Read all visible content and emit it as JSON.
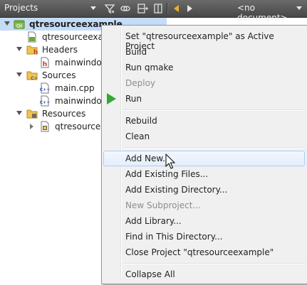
{
  "toolbar": {
    "panel_title": "Projects",
    "document_label": "<no document>",
    "icons": [
      "filter-icon",
      "link-icon",
      "split-add-icon",
      "close-pane-icon",
      "back-arrow-icon",
      "forward-arrow-icon"
    ]
  },
  "tree": {
    "project": "qtresourceexample",
    "pro_file": "qtresourceexam",
    "headers_label": "Headers",
    "header_file": "mainwindov",
    "sources_label": "Sources",
    "source_main": "main.cpp",
    "source_window": "mainwindov",
    "resources_label": "Resources",
    "resource_file": "qtresourcee"
  },
  "menu": {
    "set_active": "Set \"qtresourceexample\" as Active Project",
    "build": "Build",
    "run_qmake": "Run qmake",
    "deploy": "Deploy",
    "run": "Run",
    "rebuild": "Rebuild",
    "clean": "Clean",
    "add_new": "Add New...",
    "add_existing_files": "Add Existing Files...",
    "add_existing_directory": "Add Existing Directory...",
    "new_subproject": "New Subproject...",
    "add_library": "Add Library...",
    "find_in_directory": "Find in This Directory...",
    "close_project": "Close Project \"qtresourceexample\"",
    "collapse_all": "Collapse All"
  },
  "colors": {
    "toolbar_bg": "#474747",
    "selection_bg": "#c5dcf7",
    "menu_bg": "#f0f0f0",
    "run_green": "#34a833",
    "disabled_text": "#8d8d8d"
  }
}
